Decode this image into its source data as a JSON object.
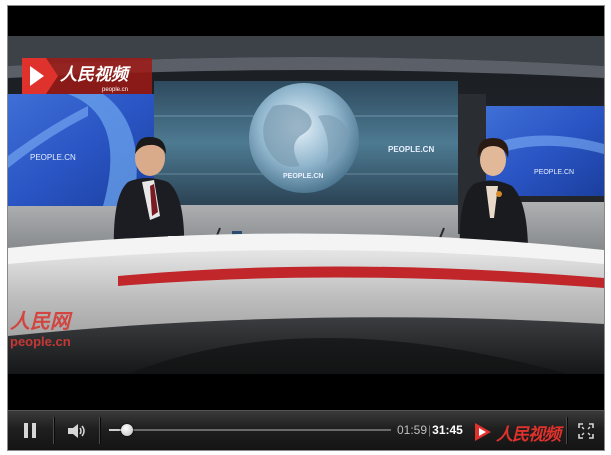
{
  "video": {
    "overlay_logo": "人民视频",
    "overlay_logo_sub": "people.cn",
    "watermark_main": "人民网",
    "watermark_sub": "people.cn",
    "screen_left_text": "PEOPLE.CN",
    "screen_center_text": "PEOPLE.CN",
    "screen_center_text2": "PEOPLE.CN",
    "screen_right_text": "PEOPLE.CN"
  },
  "controls": {
    "current_time": "01:59",
    "separator": "|",
    "total_time": "31:45",
    "progress": 0.063,
    "brand_label": "人民视频",
    "icons": {
      "play_pause": "pause-icon",
      "volume": "volume-icon",
      "fullscreen": "fullscreen-icon"
    }
  },
  "colors": {
    "brand_red": "#e0322c",
    "control_bar": "#1f1f1f"
  }
}
